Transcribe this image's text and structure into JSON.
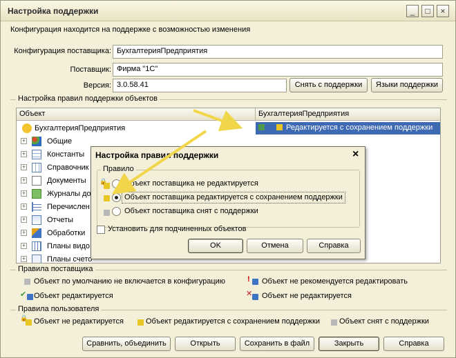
{
  "window": {
    "title": "Настройка поддержки",
    "minimize": "_",
    "maximize": "□",
    "close": "×"
  },
  "info_text": "Конфигурация находится на поддержке с возможностью изменения",
  "fields": {
    "supplier_config_label": "Конфигурация поставщика:",
    "supplier_config_value": "БухгалтерияПредприятия",
    "supplier_label": "Поставщик:",
    "supplier_value": "Фирма \"1С\"",
    "version_label": "Версия:",
    "version_value": "3.0.58.41"
  },
  "buttons_top": {
    "remove_support": "Снять с поддержки",
    "support_languages": "Языки поддержки"
  },
  "rules_group": "Настройка правил поддержки объектов",
  "tree": {
    "col_object": "Объект",
    "col_vendor": "БухгалтерияПредприятия",
    "selected_value": "Редактируется с сохранением поддержки",
    "rows": [
      {
        "label": "БухгалтерияПредприятия",
        "icon": "config-root-icon"
      },
      {
        "label": "Общие",
        "icon": "common-icon"
      },
      {
        "label": "Константы",
        "icon": "constants-icon"
      },
      {
        "label": "Справочник",
        "icon": "catalogs-icon"
      },
      {
        "label": "Документы",
        "icon": "documents-icon"
      },
      {
        "label": "Журналы до",
        "icon": "journals-icon"
      },
      {
        "label": "Перечислен",
        "icon": "enums-icon"
      },
      {
        "label": "Отчеты",
        "icon": "reports-icon"
      },
      {
        "label": "Обработки",
        "icon": "dataprocessors-icon"
      },
      {
        "label": "Планы видо",
        "icon": "chart-types-icon"
      },
      {
        "label": "Планы счето",
        "icon": "chart-accounts-icon"
      }
    ]
  },
  "dialog": {
    "title": "Настройка правил поддержки",
    "close": "×",
    "group_label": "Правило",
    "options": [
      "Объект поставщика не редактируется",
      "Объект поставщика редактируется с сохранением поддержки",
      "Объект поставщика снят с поддержки"
    ],
    "selected_index": 1,
    "checkbox_label": "Установить для подчиненных объектов",
    "ok": "OK",
    "cancel": "Отмена",
    "help": "Справка"
  },
  "legend_vendor": {
    "title": "Правила поставщика",
    "items": [
      "Объект по умолчанию не включается в конфигурацию",
      "Объект не рекомендуется редактировать",
      "Объект редактируется",
      "Объект не редактируется"
    ]
  },
  "legend_user": {
    "title": "Правила пользователя",
    "items": [
      "Объект не редактируется",
      "Объект редактируется с сохранением поддержки",
      "Объект снят с поддержки"
    ]
  },
  "buttons_bottom": {
    "compare": "Сравнить, объединить",
    "open": "Открыть",
    "save": "Сохранить в файл",
    "close": "Закрыть",
    "help": "Справка"
  },
  "colors": {
    "accent": "#3e69b3",
    "arrow": "#f2d64a",
    "window_bg": "#f3efd8"
  }
}
